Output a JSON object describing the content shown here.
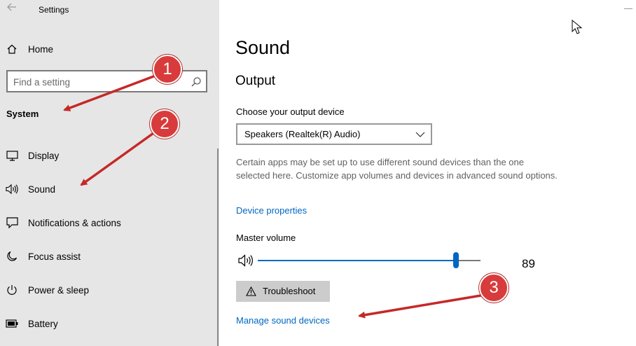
{
  "window": {
    "title": "Settings"
  },
  "sidebar": {
    "home_label": "Home",
    "search_placeholder": "Find a setting",
    "section_title": "System",
    "items": [
      {
        "label": "Display",
        "icon": "monitor-icon"
      },
      {
        "label": "Sound",
        "icon": "speaker-icon"
      },
      {
        "label": "Notifications & actions",
        "icon": "notification-icon"
      },
      {
        "label": "Focus assist",
        "icon": "moon-icon"
      },
      {
        "label": "Power & sleep",
        "icon": "power-icon"
      },
      {
        "label": "Battery",
        "icon": "battery-icon"
      }
    ]
  },
  "main": {
    "title": "Sound",
    "output_heading": "Output",
    "choose_device_label": "Choose your output device",
    "selected_device": "Speakers (Realtek(R) Audio)",
    "description": "Certain apps may be set up to use different sound devices than the one selected here. Customize app volumes and devices in advanced sound options.",
    "device_properties_link": "Device properties",
    "master_volume_label": "Master volume",
    "volume_value": "89",
    "volume_fraction": 0.89,
    "troubleshoot_label": "Troubleshoot",
    "manage_devices_link": "Manage sound devices"
  },
  "annotations": {
    "badge_1": "1",
    "badge_2": "2",
    "badge_3": "3",
    "color": "#d83b3b"
  },
  "colors": {
    "accent": "#0067c0",
    "sidebar_bg": "#e6e6e6",
    "muted_text": "#616161"
  }
}
